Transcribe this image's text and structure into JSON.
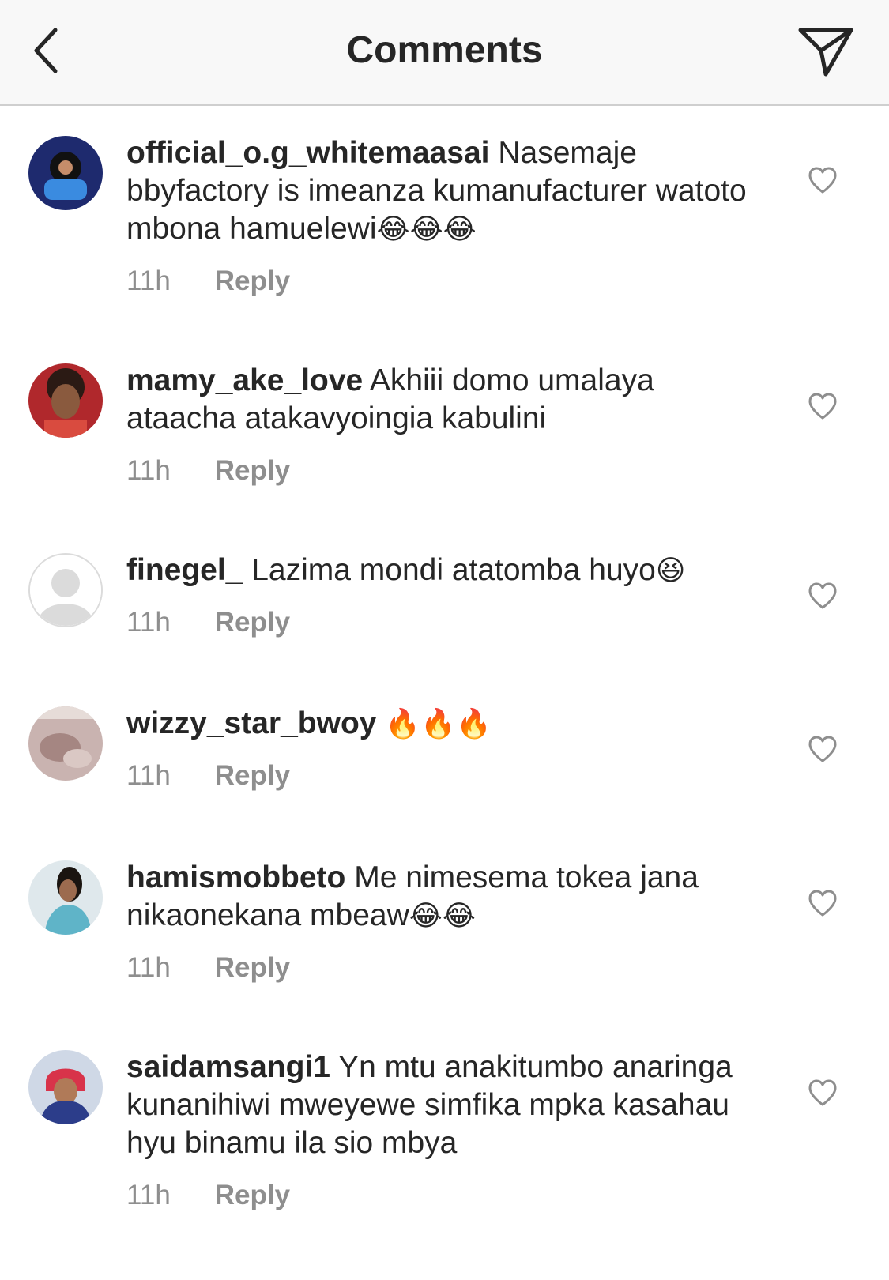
{
  "header": {
    "title": "Comments",
    "back_icon": "chevron-left-icon",
    "share_icon": "paper-plane-icon"
  },
  "comments": [
    {
      "username": "official_o.g_whitemaasai",
      "text": "Nasemaje bbyfactory is imeanza kumanufacturer watoto mbona hamuelewi",
      "emoji": "😂😂😂",
      "time": "11h",
      "reply_label": "Reply",
      "avatar_color": "#1e2a6e"
    },
    {
      "username": "mamy_ake_love",
      "text": "Akhiii domo umalaya ataacha atakavyoingia kabulini",
      "emoji": "",
      "time": "11h",
      "reply_label": "Reply",
      "avatar_color": "#b0282c"
    },
    {
      "username": "finegel_",
      "text": "Lazima mondi atatomba huyo",
      "emoji": "😆",
      "time": "11h",
      "reply_label": "Reply",
      "avatar_color": "#dbdbdb"
    },
    {
      "username": "wizzy_star_bwoy",
      "text": "",
      "emoji": "🔥🔥🔥",
      "time": "11h",
      "reply_label": "Reply",
      "avatar_color": "#c9b3b0"
    },
    {
      "username": "hamismobbeto",
      "text": "Me nimesema tokea jana nikaonekana mbeaw",
      "emoji": "😂😂",
      "time": "11h",
      "reply_label": "Reply",
      "avatar_color": "#5fb4c8"
    },
    {
      "username": "saidamsangi1",
      "text": "Yn mtu anakitumbo anaringa kunanihiwi mweyewe simfika mpka kasahau hyu binamu ila sio mbya",
      "emoji": "",
      "time": "11h",
      "reply_label": "Reply",
      "avatar_color": "#2c3d8a"
    }
  ]
}
